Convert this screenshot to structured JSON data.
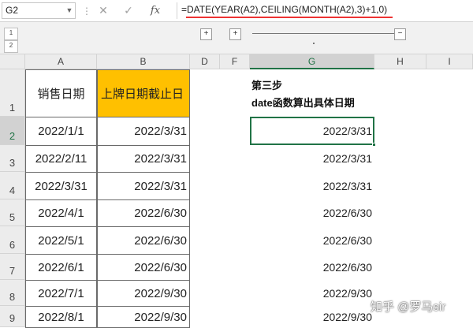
{
  "formula_bar": {
    "name_box": "G2",
    "fx_label": "fx",
    "formula": "=DATE(YEAR(A2),CEILING(MONTH(A2),3)+1,0)"
  },
  "outline": {
    "levels": [
      "1",
      "2"
    ],
    "plus": "+",
    "minus": "−"
  },
  "columns": [
    "A",
    "B",
    "D",
    "F",
    "G",
    "H",
    "I"
  ],
  "rows": [
    "1",
    "2",
    "3",
    "4",
    "5",
    "6",
    "7",
    "8",
    "9"
  ],
  "table": {
    "header_a": "销售日期",
    "header_b": "上牌日期截止日",
    "sale_dates": [
      "2022/1/1",
      "2022/2/11",
      "2022/3/31",
      "2022/4/1",
      "2022/5/1",
      "2022/6/1",
      "2022/7/1",
      "2022/8/1"
    ],
    "deadline_dates": [
      "2022/3/31",
      "2022/3/31",
      "2022/3/31",
      "2022/6/30",
      "2022/6/30",
      "2022/6/30",
      "2022/9/30",
      "2022/9/30"
    ]
  },
  "note": {
    "line1": "第三步",
    "line2": "date函数算出具体日期"
  },
  "g_results": [
    "2022/3/31",
    "2022/3/31",
    "2022/3/31",
    "2022/6/30",
    "2022/6/30",
    "2022/6/30",
    "2022/9/30",
    "2022/9/30"
  ],
  "watermark": "知乎 @罗马sir",
  "colors": {
    "header_fill": "#ffc000",
    "active_border": "#217346",
    "underline": "#e33333"
  }
}
